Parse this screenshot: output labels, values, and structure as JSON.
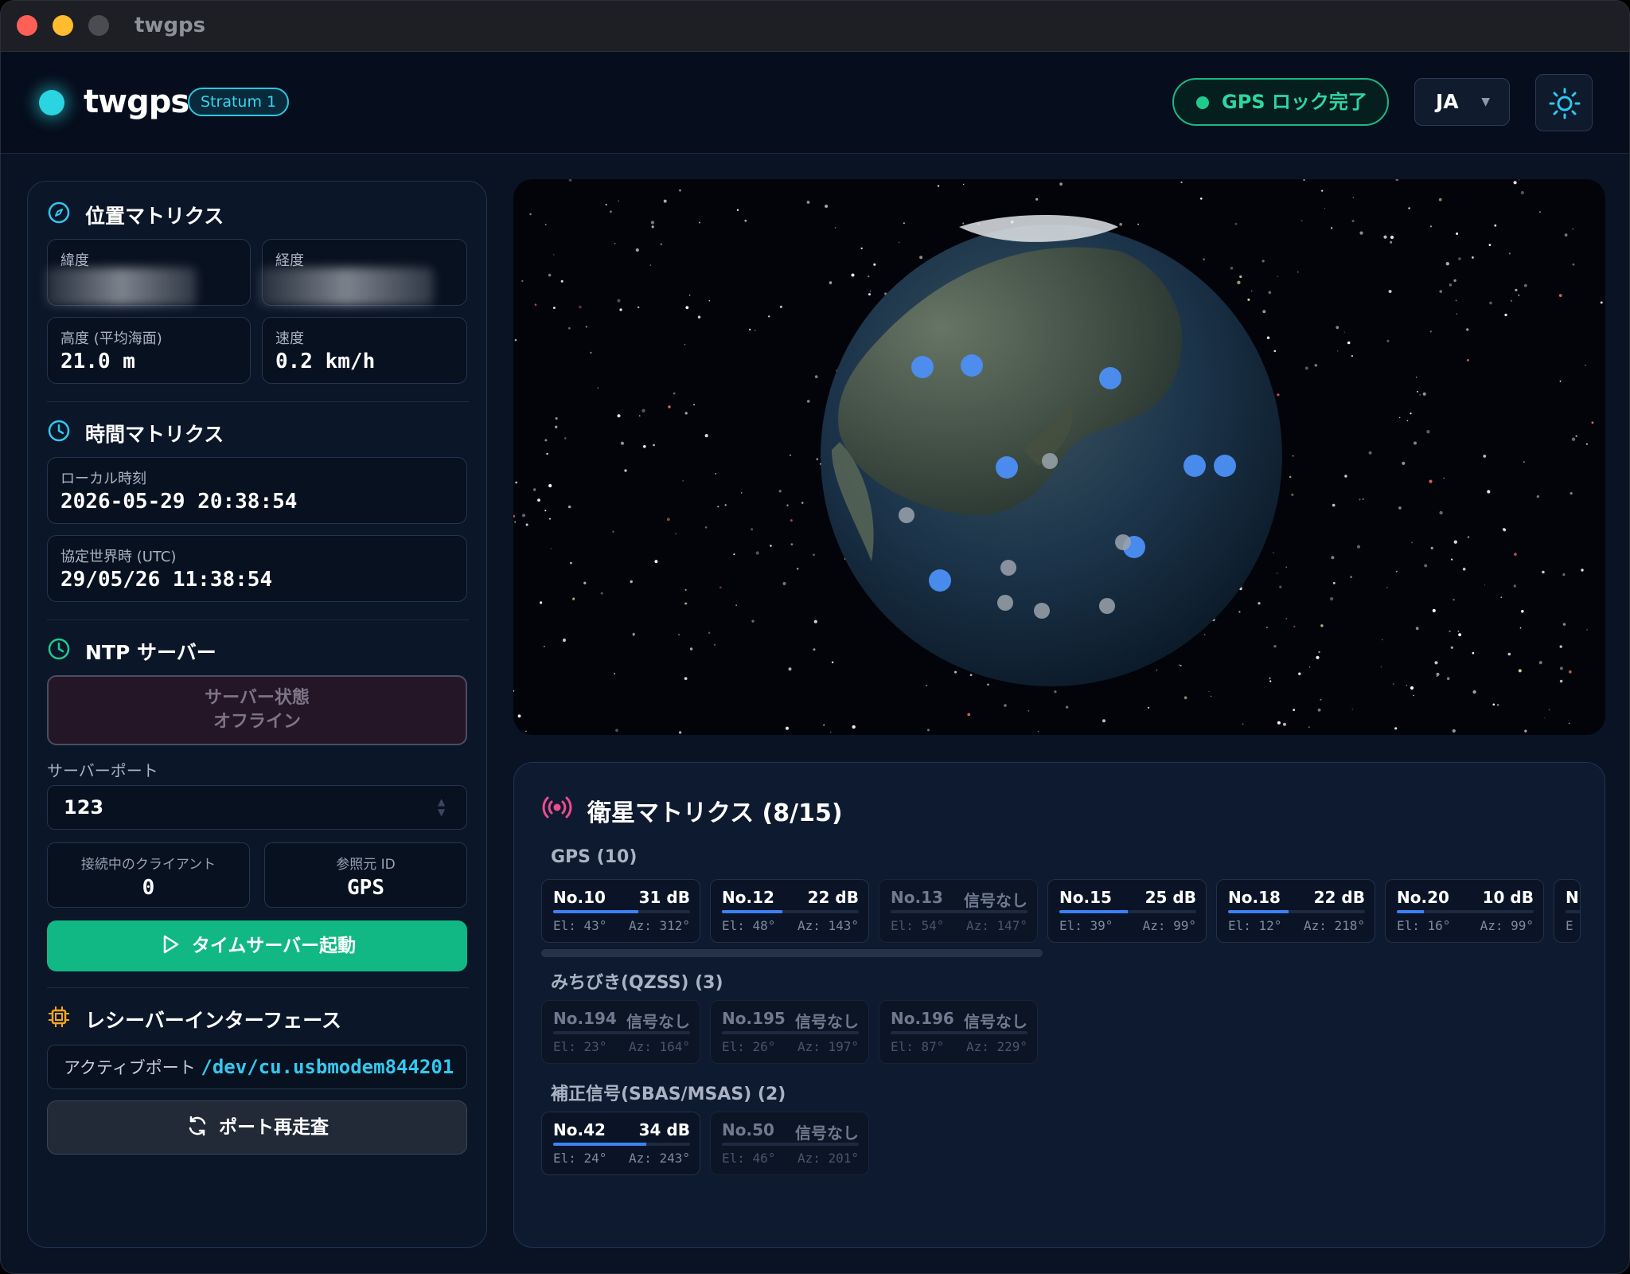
{
  "window": {
    "title": "twgps"
  },
  "header": {
    "logo": "twgps",
    "badge": "Stratum 1",
    "gps_status": "GPS ロック完了",
    "lang": "JA",
    "colors": {
      "accent": "#2ad4e0",
      "ok": "#1fca8c"
    }
  },
  "position": {
    "title": "位置マトリクス",
    "lat_label": "緯度",
    "lon_label": "経度",
    "alt_label": "高度 (平均海面)",
    "alt_value": "21.0 m",
    "speed_label": "速度",
    "speed_value": "0.2 km/h"
  },
  "time": {
    "title": "時間マトリクス",
    "local_label": "ローカル時刻",
    "local_value": "2026-05-29 20:38:54",
    "utc_label": "協定世界時 (UTC)",
    "utc_value": "29/05/26 11:38:54"
  },
  "ntp": {
    "title": "NTP サーバー",
    "status_line1": "サーバー状態",
    "status_line2": "オフライン",
    "port_label": "サーバーポート",
    "port_value": "123",
    "clients_label": "接続中のクライアント",
    "clients_value": "0",
    "refid_label": "参照元 ID",
    "refid_value": "GPS",
    "start_label": "タイムサーバー起動"
  },
  "receiver": {
    "title": "レシーバーインターフェース",
    "active_label": "アクティブポート",
    "active_path": "/dev/cu.usbmodem844201",
    "rescan_label": "ポート再走査"
  },
  "satellites": {
    "title": "衛星マトリクス (8/15)",
    "groups": [
      {
        "title": "GPS (10)",
        "sats": [
          {
            "no": "No.10",
            "sig": "31 dB",
            "level": 0.62,
            "el": "El: 43°",
            "az": "Az: 312°",
            "on": true
          },
          {
            "no": "No.12",
            "sig": "22 dB",
            "level": 0.44,
            "el": "El: 48°",
            "az": "Az: 143°",
            "on": true
          },
          {
            "no": "No.13",
            "sig": "信号なし",
            "level": 0,
            "el": "El: 54°",
            "az": "Az: 147°",
            "on": false
          },
          {
            "no": "No.15",
            "sig": "25 dB",
            "level": 0.5,
            "el": "El: 39°",
            "az": "Az: 99°",
            "on": true
          },
          {
            "no": "No.18",
            "sig": "22 dB",
            "level": 0.44,
            "el": "El: 12°",
            "az": "Az: 218°",
            "on": true
          },
          {
            "no": "No.20",
            "sig": "10 dB",
            "level": 0.2,
            "el": "El: 16°",
            "az": "Az: 99°",
            "on": true
          },
          {
            "no": "N",
            "sig": "",
            "level": 0,
            "el": "E",
            "az": "",
            "on": true
          }
        ]
      },
      {
        "title": "みちびき(QZSS) (3)",
        "sats": [
          {
            "no": "No.194",
            "sig": "信号なし",
            "level": 0,
            "el": "El: 23°",
            "az": "Az: 164°",
            "on": false
          },
          {
            "no": "No.195",
            "sig": "信号なし",
            "level": 0,
            "el": "El: 26°",
            "az": "Az: 197°",
            "on": false
          },
          {
            "no": "No.196",
            "sig": "信号なし",
            "level": 0,
            "el": "El: 87°",
            "az": "Az: 229°",
            "on": false
          }
        ]
      },
      {
        "title": "補正信号(SBAS/MSAS) (2)",
        "sats": [
          {
            "no": "No.42",
            "sig": "34 dB",
            "level": 0.68,
            "el": "El: 24°",
            "az": "Az: 243°",
            "on": true
          },
          {
            "no": "No.50",
            "sig": "信号なし",
            "level": 0,
            "el": "El: 46°",
            "az": "Az: 201°",
            "on": false
          }
        ]
      }
    ]
  }
}
